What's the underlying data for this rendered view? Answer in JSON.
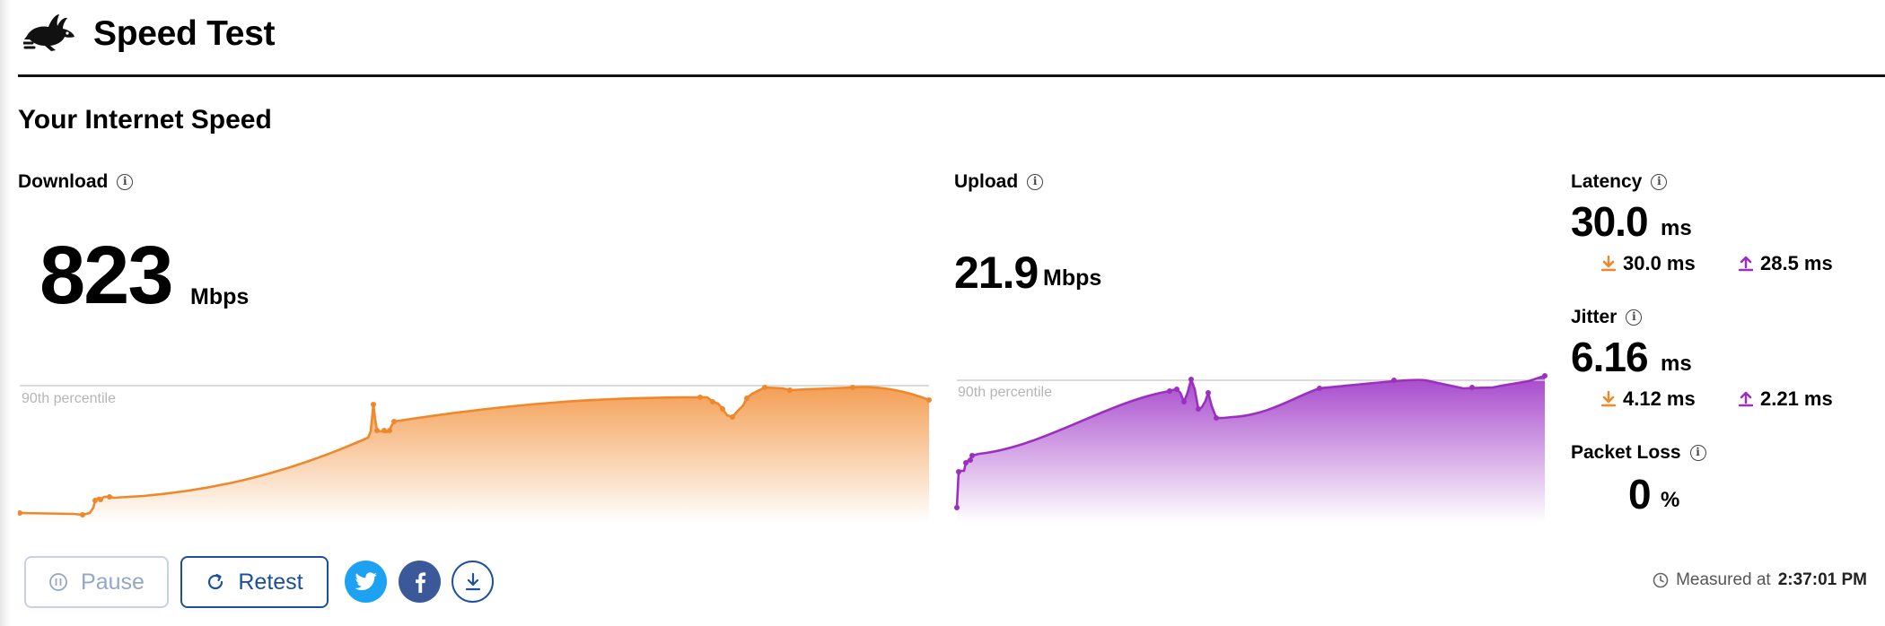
{
  "header": {
    "title": "Speed Test",
    "logo_icon": "rabbit-icon"
  },
  "section_title": "Your Internet Speed",
  "download": {
    "label": "Download",
    "value": "823",
    "unit": "Mbps",
    "percentile_label": "90th percentile",
    "color": "#f0872a"
  },
  "upload": {
    "label": "Upload",
    "value": "21.9",
    "unit": "Mbps",
    "percentile_label": "90th percentile",
    "color": "#9b2fbf"
  },
  "latency": {
    "label": "Latency",
    "value": "30.0",
    "unit": "ms",
    "down_value": "30.0 ms",
    "up_value": "28.5 ms"
  },
  "jitter": {
    "label": "Jitter",
    "value": "6.16",
    "unit": "ms",
    "down_value": "4.12 ms",
    "up_value": "2.21 ms"
  },
  "packet_loss": {
    "label": "Packet Loss",
    "value": "0",
    "unit": "%"
  },
  "buttons": {
    "pause": "Pause",
    "retest": "Retest"
  },
  "measured": {
    "prefix": "Measured at",
    "time": "2:37:01 PM"
  },
  "colors": {
    "accent": "#1c4fa0",
    "download": "#f0872a",
    "upload": "#9b2fbf",
    "twitter": "#1da1f2",
    "facebook": "#3b5998"
  }
}
